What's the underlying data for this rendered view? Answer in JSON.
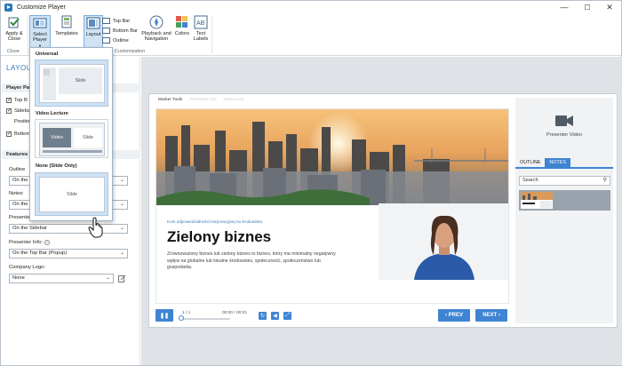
{
  "window": {
    "title": "Customize Player",
    "controls": [
      "—",
      "☐",
      "✕"
    ]
  },
  "ribbon": {
    "apply_close": "Apply & Close",
    "select_player": "Select Player",
    "templates": "Templates",
    "layout": "Layout",
    "top_bar": "Top Bar",
    "bottom_bar": "Bottom Bar",
    "outline": "Outline",
    "playback_navigation": "Playback and Navigation",
    "colors": "Colors",
    "text_labels": "Text Labels",
    "group_close": "Close",
    "group_customization": "Customization"
  },
  "left_panel": {
    "title": "LAYOU",
    "player_panels_header": "Player Pa",
    "checks": [
      "Top B",
      "Sideba",
      "Bottom"
    ],
    "position_label": "Positio",
    "features_header": "Features",
    "outline_label": "Outline",
    "outline_value": "On the",
    "notes_label": "Notes:",
    "notes_value": "On the",
    "presenter_video_label": "Presente",
    "presenter_video_value": "On the Sidebar",
    "presenter_info_label": "Presenter Info:",
    "presenter_info_value": "On the Top Bar (Popup)",
    "company_logo_label": "Company Logo:",
    "company_logo_value": "None"
  },
  "dropdown": {
    "universal_label": "Universal",
    "universal_slide": "Slide",
    "video_lecture_label": "Video Lecture",
    "video_lecture_video": "Video",
    "video_lecture_slide": "Slide",
    "none_label": "None (Slide Only)",
    "none_slide": "Slide"
  },
  "player": {
    "tabs": [
      "Marker Tools",
      "Presenter Info",
      "Resources"
    ],
    "course_label": "Kurs odpowiedzialności korporacyjnej na środowisko",
    "headline": "Zielony biznes",
    "body": "Zrównoważony biznes lub zielony biznes to biznes, który ma minimalny negatywny wpływ na globalne lub lokalne środowisko, społeczność, społeczeństwo lub gospodarkę.",
    "slide_counter": "1 / 1",
    "time": "00:00 / 00:01",
    "prev": "‹ PREV",
    "next": "NEXT ›"
  },
  "sidebar": {
    "presenter_video": "Presenter Video",
    "tab_outline": "OUTLINE",
    "tab_notes": "NOTES",
    "search_placeholder": "Search"
  },
  "colors": {
    "accent": "#3f84d2",
    "panel_title": "#3b79b8",
    "stage_bg": "#dfe3e7",
    "active_button": "#cfe3f4"
  }
}
